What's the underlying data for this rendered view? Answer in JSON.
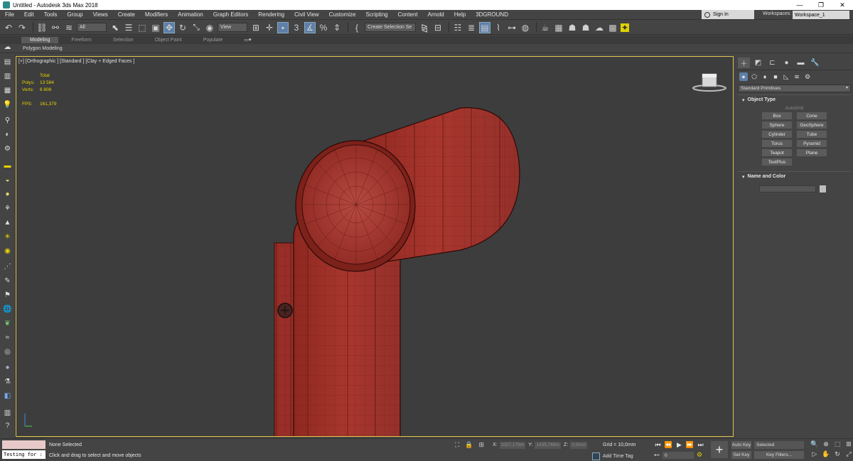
{
  "window": {
    "title": "Untitled - Autodesk 3ds Max 2018",
    "controls": [
      "—",
      "❐",
      "✕"
    ]
  },
  "menubar": {
    "items": [
      "File",
      "Edit",
      "Tools",
      "Group",
      "Views",
      "Create",
      "Modifiers",
      "Animation",
      "Graph Editors",
      "Rendering",
      "Civil View",
      "Customize",
      "Scripting",
      "Content",
      "Arnold",
      "Help",
      "3DGROUND"
    ],
    "sign_in": "Sign In",
    "workspaces_label": "Workspaces:",
    "workspace_value": "Workspace_1"
  },
  "toolbar": {
    "selection_filter": "All",
    "ref_coord": "View",
    "named_selection": "Create Selection Se"
  },
  "ribbon": {
    "tabs": [
      "Modeling",
      "Freeform",
      "Selection",
      "Object Paint",
      "Populate"
    ],
    "active_tab": "Modeling",
    "panel_label": "Polygon Modeling"
  },
  "viewport": {
    "label": "[+] [Orthographic ] [Standard ] [Clay + Edged Faces ]",
    "stats": {
      "total_label": "Total",
      "polys_label": "Polys:",
      "polys_value": "13 584",
      "verts_label": "Verts:",
      "verts_value": "6 808",
      "fps_label": "FPS:",
      "fps_value": "161,379"
    }
  },
  "command_panel": {
    "primitives_dropdown": "Standard Primitives",
    "object_type_title": "Object Type",
    "autogrid": "AutoGrid",
    "buttons": [
      "Box",
      "Cone",
      "Sphere",
      "GeoSphere",
      "Cylinder",
      "Tube",
      "Torus",
      "Pyramid",
      "Teapot",
      "Plane",
      "TextPlus"
    ],
    "name_color_title": "Name and Color"
  },
  "statusbar": {
    "script_text": "Testing for :",
    "selection_status": "None Selected",
    "prompt": "Click and drag to select and move objects",
    "x_label": "X:",
    "x_value": "3327,179m",
    "y_label": "Y:",
    "y_value": "1435,768m",
    "z_label": "Z:",
    "z_value": "0,0mm",
    "grid": "Grid = 10,0mm",
    "add_time_tag": "Add Time Tag",
    "frame": "0",
    "auto_key": "Auto Key",
    "set_key": "Set Key",
    "selected": "Selected",
    "key_filters": "Key Filters..."
  },
  "colors": {
    "model": "#a4312a",
    "viewport_border": "#e3c44b",
    "stats_text": "#e8d400"
  }
}
